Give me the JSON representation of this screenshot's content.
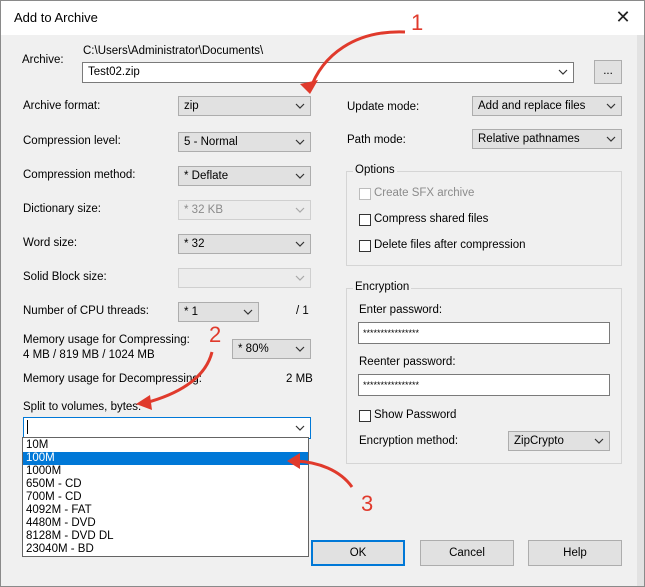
{
  "window": {
    "title": "Add to Archive"
  },
  "archive": {
    "label": "Archive:",
    "path": "C:\\Users\\Administrator\\Documents\\",
    "filename": "Test02.zip",
    "browse_label": "..."
  },
  "left": {
    "archive_format": {
      "label": "Archive format:",
      "value": "zip"
    },
    "compression_level": {
      "label": "Compression level:",
      "value": "5 - Normal"
    },
    "compression_method": {
      "label": "Compression method:",
      "value": "*  Deflate"
    },
    "dictionary_size": {
      "label": "Dictionary size:",
      "value": "*  32 KB"
    },
    "word_size": {
      "label": "Word size:",
      "value": "*  32"
    },
    "solid_block": {
      "label": "Solid Block size:",
      "value": ""
    },
    "cpu_threads": {
      "label": "Number of CPU threads:",
      "value": "*  1",
      "max": "/ 1"
    },
    "mem_compress": {
      "label": "Memory usage for Compressing:",
      "detail": "4 MB / 819 MB / 1024 MB",
      "value": "* 80%"
    },
    "mem_decompress": {
      "label": "Memory usage for Decompressing:",
      "value": "2 MB"
    },
    "split": {
      "label": "Split to volumes, bytes:",
      "value": "",
      "options": [
        "10M",
        "100M",
        "1000M",
        "650M - CD",
        "700M - CD",
        "4092M - FAT",
        "4480M - DVD",
        "8128M - DVD DL",
        "23040M - BD"
      ],
      "selected_index": 1
    }
  },
  "right": {
    "update_mode": {
      "label": "Update mode:",
      "value": "Add and replace files"
    },
    "path_mode": {
      "label": "Path mode:",
      "value": "Relative pathnames"
    },
    "options": {
      "title": "Options",
      "create_sfx": "Create SFX archive",
      "compress_shared": "Compress shared files",
      "delete_after": "Delete files after compression"
    },
    "encryption": {
      "title": "Encryption",
      "enter_label": "Enter password:",
      "enter_value": "****************",
      "reenter_label": "Reenter password:",
      "reenter_value": "****************",
      "show_password": "Show Password",
      "method_label": "Encryption method:",
      "method_value": "ZipCrypto"
    }
  },
  "buttons": {
    "ok": "OK",
    "cancel": "Cancel",
    "help": "Help"
  },
  "annotations": {
    "one": "1",
    "two": "2",
    "three": "3",
    "color": "#e03a2c"
  }
}
